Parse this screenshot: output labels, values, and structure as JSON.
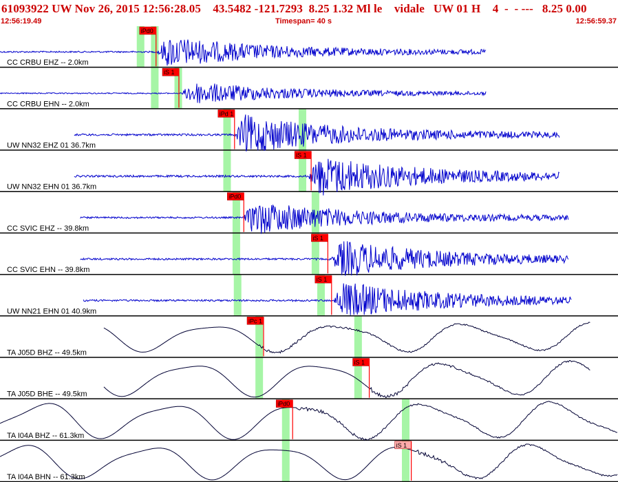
{
  "header": {
    "title": "61093922 UW Nov 26, 2015 12:56:28.05    43.5482 -121.7293  8.25 1.32 Ml le    vidale   UW 01 H    4  -  - ---   8.25 0.00",
    "start_time": "12:56:19.49",
    "timespan": "Timespan=  40 s",
    "end_time": "12:56:59.37"
  },
  "colors": {
    "title": "#cc0000",
    "waveform": "#0000cc",
    "waveform_lp": "#000033",
    "pick_box": "#ff0000",
    "pick_box_light": "#ffaaaa",
    "window_band": "#a6f5a6"
  },
  "chart_data": {
    "type": "line",
    "title": "61093922 UW Nov 26, 2015 12:56:28.05",
    "x_range": [
      "12:56:19.49",
      "12:56:59.37"
    ],
    "timespan_s": 40,
    "traces": [
      {
        "label": "CC CRBU EHZ -- 2.0km",
        "pick": "iPd0",
        "pick_pos": 0.228,
        "marks": [
          0.228,
          0.251
        ],
        "start": 0.0,
        "end": 0.787,
        "onset": 0.255,
        "amp": 0.38,
        "type": "sp"
      },
      {
        "label": "CC CRBU EHN -- 2.0km",
        "pick": "iS 1",
        "pick_pos": 0.265,
        "marks": [
          0.251,
          0.289
        ],
        "start": 0.0,
        "end": 0.787,
        "onset": 0.295,
        "amp": 0.28,
        "type": "sp"
      },
      {
        "label": "UW NN32 EHZ 01 36.7km",
        "pick": "iPd 1",
        "pick_pos": 0.355,
        "marks": [
          0.368,
          0.49
        ],
        "start": 0.12,
        "end": 0.906,
        "onset": 0.38,
        "amp": 0.48,
        "type": "sp"
      },
      {
        "label": "UW NN32 EHN 01 36.7km",
        "pick": "iS 1",
        "pick_pos": 0.479,
        "marks": [
          0.368,
          0.49
        ],
        "start": 0.12,
        "end": 0.906,
        "onset": 0.5,
        "amp": 0.5,
        "type": "sp"
      },
      {
        "label": "CC SVIC EHZ -- 39.8km",
        "pick": "iPd0",
        "pick_pos": 0.37,
        "marks": [
          0.383,
          0.511
        ],
        "start": 0.13,
        "end": 0.92,
        "onset": 0.395,
        "amp": 0.42,
        "type": "sp"
      },
      {
        "label": "CC SVIC EHN -- 39.8km",
        "pick": "iS 1",
        "pick_pos": 0.506,
        "marks": [
          0.383,
          0.511
        ],
        "start": 0.13,
        "end": 0.92,
        "onset": 0.537,
        "amp": 0.45,
        "type": "sp"
      },
      {
        "label": "UW NN21 EHN 01 40.9km",
        "pick": "iS 1",
        "pick_pos": 0.512,
        "marks": [
          0.385,
          0.52
        ],
        "start": 0.135,
        "end": 0.925,
        "onset": 0.54,
        "amp": 0.45,
        "type": "sp"
      },
      {
        "label": "TA J05D BHZ -- 49.5km",
        "pick": "iPc 1",
        "pick_pos": 0.402,
        "marks": [
          0.42,
          0.58
        ],
        "start": 0.168,
        "end": 0.955,
        "onset": 0.42,
        "amp": 0.3,
        "type": "lp"
      },
      {
        "label": "TA J05D BHE -- 49.5km",
        "pick": "iS 1",
        "pick_pos": 0.573,
        "marks": [
          0.42,
          0.58
        ],
        "start": 0.168,
        "end": 0.955,
        "onset": 0.6,
        "amp": 0.36,
        "type": "lp"
      },
      {
        "label": "TA I04A BHZ -- 61.3km",
        "pick": "iPd0",
        "pick_pos": 0.449,
        "marks": [
          0.463,
          0.657
        ],
        "start": 0.0,
        "end": 1.0,
        "onset": 0.48,
        "amp": 0.38,
        "type": "lp"
      },
      {
        "label": "TA I04A BHN -- 61.3km",
        "pick": "iS 1",
        "pick_pos": 0.641,
        "marks": [
          0.463,
          0.657
        ],
        "start": 0.0,
        "end": 1.0,
        "onset": 0.672,
        "amp": 0.36,
        "type": "lp"
      }
    ]
  }
}
